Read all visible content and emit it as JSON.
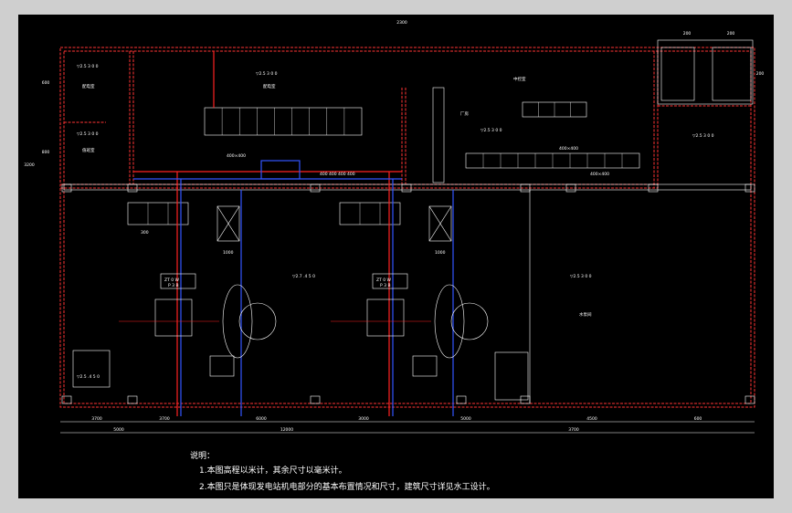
{
  "drawing": {
    "background": "#000000",
    "wall_color": "#ff3333",
    "line_color": "#ffffff",
    "pipe_red": "#ff2222",
    "pipe_blue": "#3355ff",
    "top_dimension": "2300",
    "top_right_dims": [
      "200",
      "200"
    ],
    "right_side_dims": [
      "200"
    ],
    "left_side_dims": [
      "600",
      "3200",
      "800"
    ],
    "elevation_labels": [
      "▽2.5 3 0 0",
      "▽2.5 3 0 0",
      "▽2.5 3 0 0",
      "▽2.5 3 0 0",
      "▽2.5 3 0 0",
      "▽2.5 3 0 0",
      "▽2.5 3 0 0",
      "▽2.7 .4 5 0",
      "▽2.5 3 0 0",
      "▽2.5 .4 5 0"
    ],
    "room_labels": [
      "配电室",
      "配电室",
      "值班室",
      "厂房",
      "中控室",
      "水泵间"
    ],
    "equipment_labels": [
      "ZT 0 W",
      "P 3 B",
      "ZT 0 W",
      "P 3 B"
    ],
    "small_labels": [
      "400×400",
      "400 400 400 400",
      "400×400",
      "400×400",
      "1000",
      "1000",
      "300"
    ],
    "bottom_dims_row1": [
      "3700",
      "3700",
      "6000",
      "3000",
      "5000",
      "4500",
      "600"
    ],
    "bottom_dims_row2": [
      "5000",
      "12000",
      "3700"
    ],
    "notes_title": "说明：",
    "notes": [
      "1.本图高程以米计，其余尺寸以毫米计。",
      "2.本图只是体现发电站机电部分的基本布置情况和尺寸，建筑尺寸详见水工设计。"
    ]
  }
}
